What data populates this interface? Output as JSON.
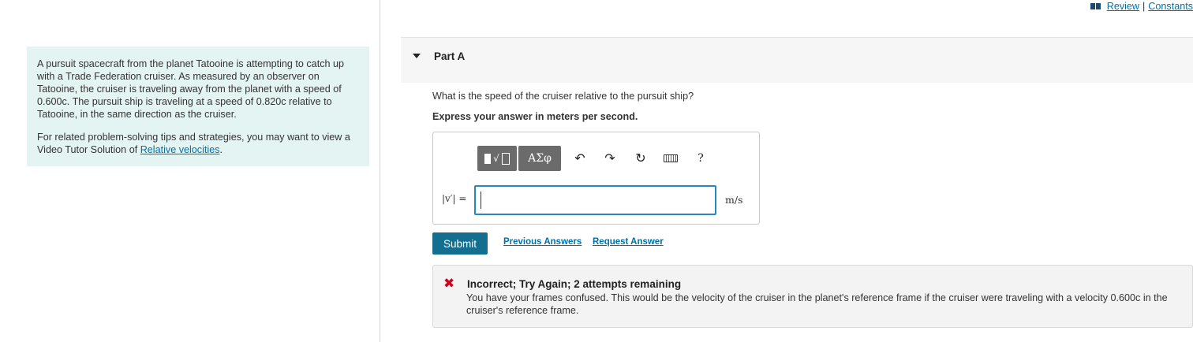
{
  "header": {
    "review_link": "Review",
    "separator": "|",
    "constants_link": "Constants"
  },
  "intro": {
    "paragraph1": "A pursuit spacecraft from the planet Tatooine is attempting to catch up with a Trade Federation cruiser. As measured by an observer on Tatooine, the cruiser is traveling away from the planet with a speed of 0.600c. The pursuit ship is traveling at a speed of 0.820c relative to Tatooine, in the same direction as the cruiser.",
    "paragraph2_prefix": "For related problem-solving tips and strategies, you may want to view a Video Tutor Solution of ",
    "paragraph2_link": "Relative velocities",
    "paragraph2_suffix": "."
  },
  "part": {
    "title": "Part A",
    "question": "What is the speed of the cruiser relative to the pursuit ship?",
    "instruction": "Express your answer in meters per second."
  },
  "toolbar": {
    "templates_icon": "templates-icon",
    "symbols_label": "ΑΣφ",
    "undo_glyph": "↶",
    "redo_glyph": "↷",
    "reset_glyph": "↻",
    "help_label": "?"
  },
  "answer": {
    "variable_label": "|v′| =",
    "value": "",
    "unit": "m/s"
  },
  "actions": {
    "submit_label": "Submit",
    "previous_answers_label": "Previous Answers",
    "request_answer_label": "Request Answer"
  },
  "feedback": {
    "status_color": "#d0021b",
    "title": "Incorrect; Try Again; 2 attempts remaining",
    "message": "You have your frames confused. This would be the velocity of the cruiser in the planet's reference frame if the cruiser were traveling with a velocity 0.600c in the cruiser's reference frame."
  }
}
